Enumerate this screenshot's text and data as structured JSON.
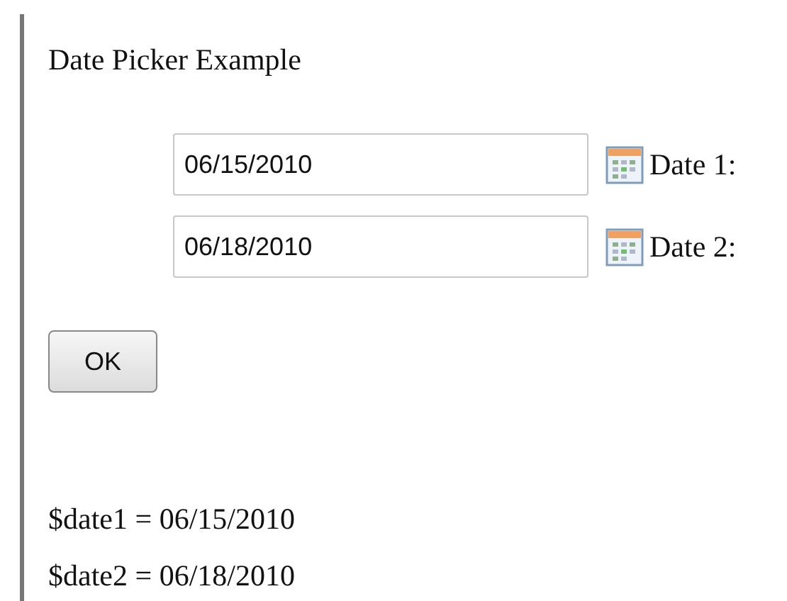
{
  "title": "Date Picker Example",
  "date_fields": [
    {
      "value": "06/15/2010",
      "label": "Date 1:"
    },
    {
      "value": "06/18/2010",
      "label": "Date 2:"
    }
  ],
  "button": "OK",
  "results": [
    "$date1 = 06/15/2010",
    "$date2 = 06/18/2010"
  ]
}
